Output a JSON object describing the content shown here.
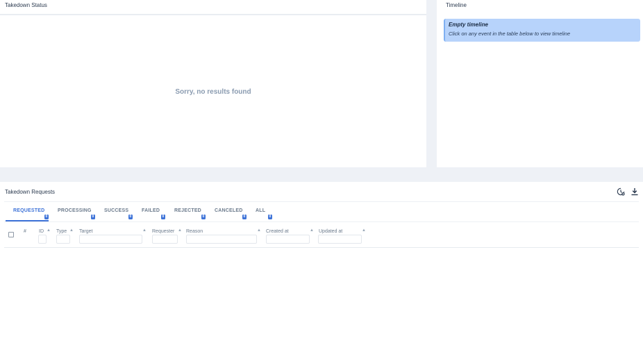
{
  "status_panel": {
    "title": "Takedown Status",
    "empty_message": "Sorry, no results found"
  },
  "timeline_panel": {
    "title": "Timeline",
    "card_title": "Empty timeline",
    "card_text": "Click on any event in the table below to view timeline"
  },
  "requests_panel": {
    "title": "Takedown Requests",
    "toolbar": {
      "history_icon": "history-icon",
      "download_icon": "download-icon"
    },
    "tabs": [
      {
        "label": "REQUESTED",
        "count": "0",
        "active": true
      },
      {
        "label": "PROCESSING",
        "count": "0"
      },
      {
        "label": "SUCCESS",
        "count": "0"
      },
      {
        "label": "FAILED",
        "count": "0"
      },
      {
        "label": "REJECTED",
        "count": "0"
      },
      {
        "label": "CANCELED",
        "count": "0"
      },
      {
        "label": "ALL",
        "count": "0"
      }
    ],
    "columns": [
      {
        "label": "#"
      },
      {
        "label": "ID"
      },
      {
        "label": "Type"
      },
      {
        "label": "Target"
      },
      {
        "label": "Requester"
      },
      {
        "label": "Reason"
      },
      {
        "label": "Created at"
      },
      {
        "label": "Updated at"
      }
    ]
  },
  "colors": {
    "accent": "#3e73d8",
    "timeline_card": "#b7d3fb",
    "page_bg": "#eef1f6"
  }
}
